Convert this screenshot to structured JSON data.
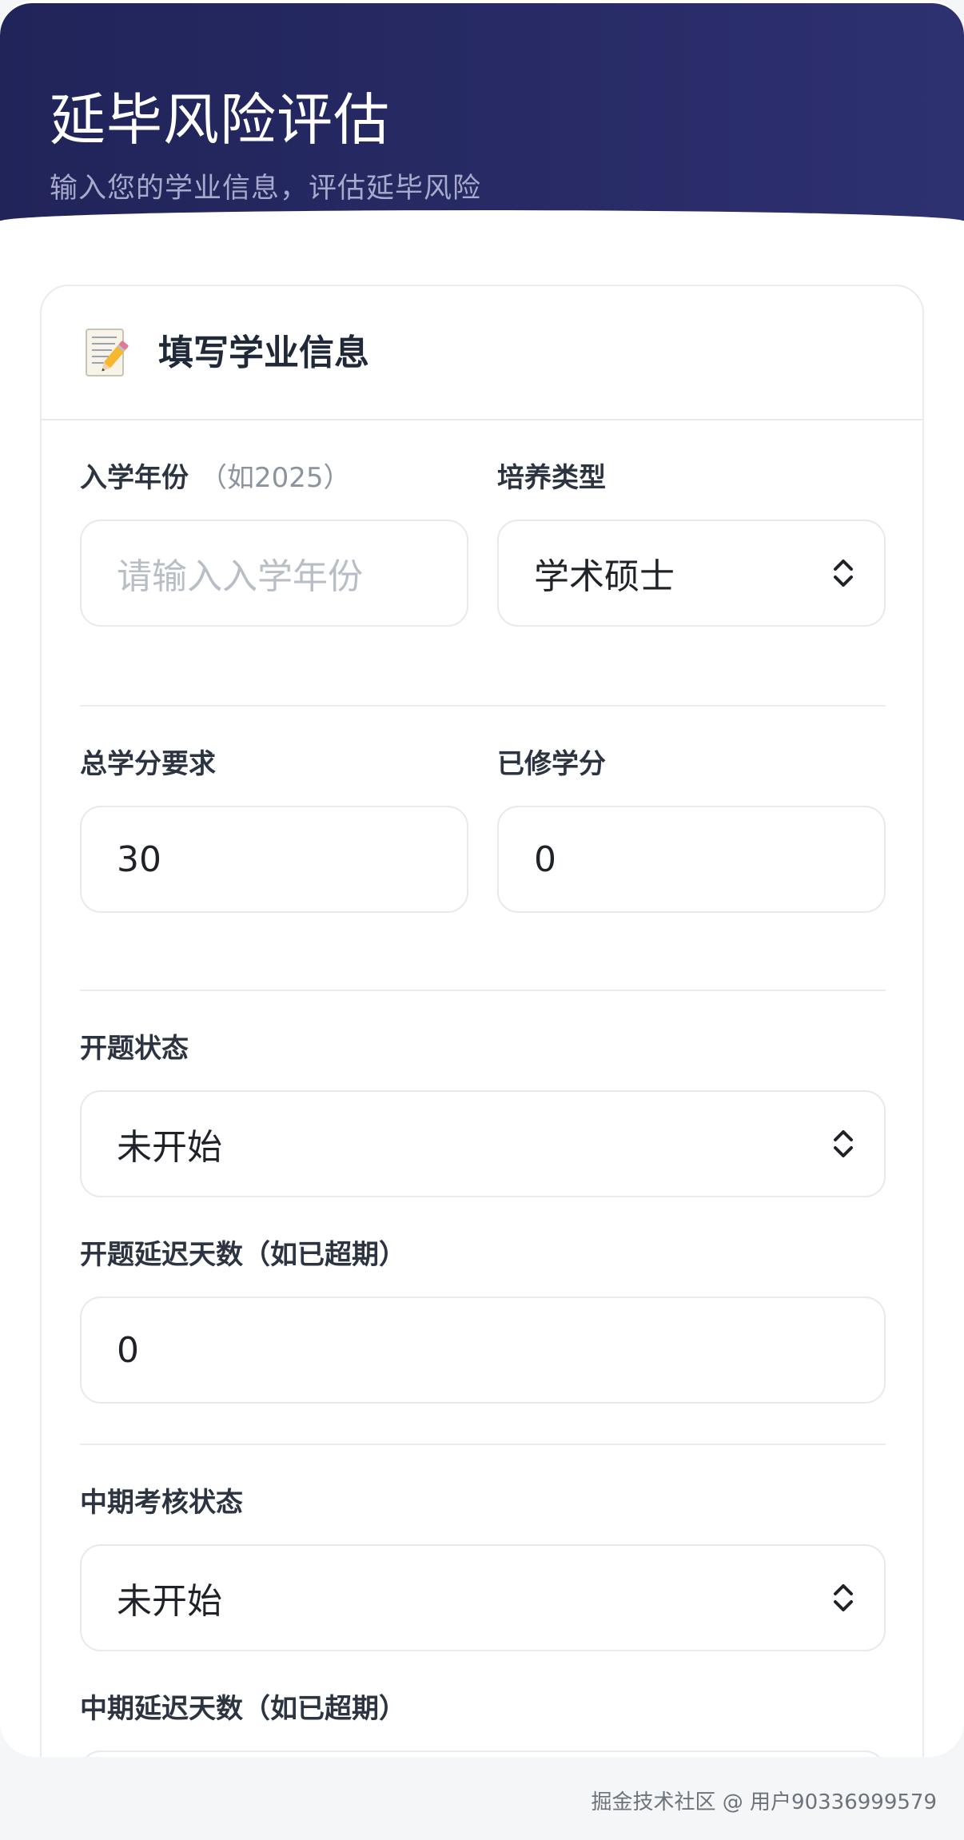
{
  "header": {
    "title": "延毕风险评估",
    "subtitle": "输入您的学业信息，评估延毕风险"
  },
  "card": {
    "icon": "memo-icon",
    "title": "填写学业信息"
  },
  "form": {
    "enrollment_year": {
      "label": "入学年份",
      "hint": "（如2025）",
      "placeholder": "请输入入学年份",
      "value": ""
    },
    "program_type": {
      "label": "培养类型",
      "value": "学术硕士"
    },
    "total_credits": {
      "label": "总学分要求",
      "value": "30"
    },
    "earned_credits": {
      "label": "已修学分",
      "value": "0"
    },
    "proposal_status": {
      "label": "开题状态",
      "value": "未开始"
    },
    "proposal_delay": {
      "label": "开题延迟天数（如已超期）",
      "value": "0"
    },
    "midterm_status": {
      "label": "中期考核状态",
      "value": "未开始"
    },
    "midterm_delay": {
      "label": "中期延迟天数（如已超期）"
    }
  },
  "watermark": "掘金技术社区 @ 用户90336999579",
  "colors": {
    "header_bg": "#242760",
    "card_border": "#e8ecf0",
    "text_primary": "#1f2329",
    "placeholder": "#b8bec6"
  }
}
